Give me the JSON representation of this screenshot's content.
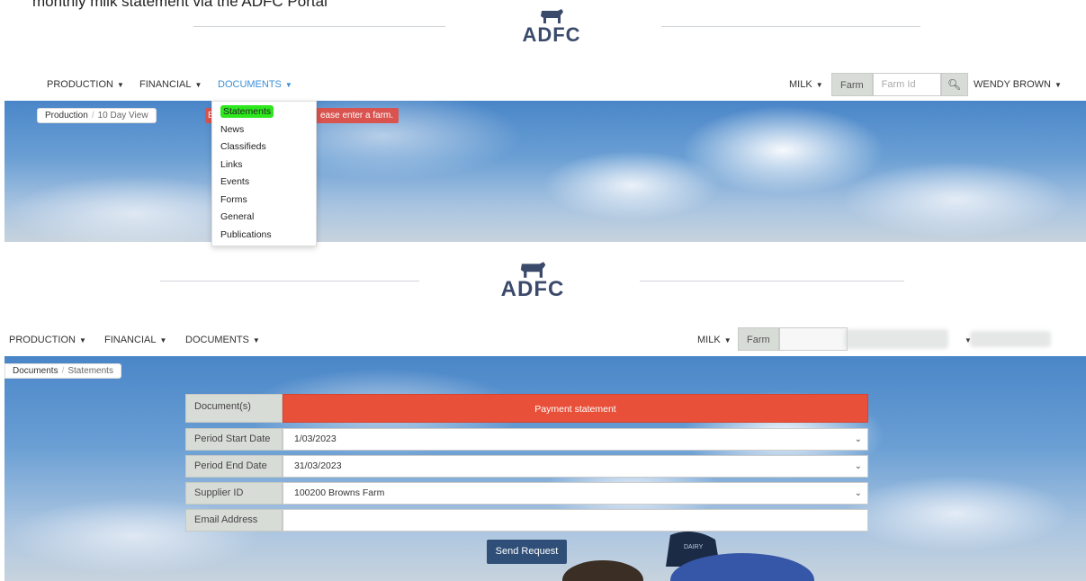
{
  "caption": "monthly milk statement via the ADFC Portal",
  "brand": {
    "name": "ADFC",
    "accent": "#3b4a6b"
  },
  "top": {
    "nav": {
      "production": "PRODUCTION",
      "financial": "FINANCIAL",
      "documents": "DOCUMENTS",
      "milk": "MILK",
      "farm_label": "Farm",
      "farm_placeholder": "Farm Id",
      "search_icon": "search-icon",
      "user": "WENDY BROWN"
    },
    "breadcrumb": {
      "section": "Production",
      "page": "10 Day View"
    },
    "alert_left": "E",
    "alert": "ease enter a farm.",
    "dropdown": [
      "Statements",
      "News",
      "Classifieds",
      "Links",
      "Events",
      "Forms",
      "General",
      "Publications"
    ],
    "highlight_color": "#2ee81e"
  },
  "bottom": {
    "nav": {
      "production": "PRODUCTION",
      "financial": "FINANCIAL",
      "documents": "DOCUMENTS",
      "milk": "MILK",
      "farm_label": "Farm"
    },
    "breadcrumb": {
      "section": "Documents",
      "page": "Statements"
    },
    "form": {
      "documents_label": "Document(s)",
      "documents_value": "Payment statement",
      "start_label": "Period Start Date",
      "start_value": "1/03/2023",
      "end_label": "Period End Date",
      "end_value": "31/03/2023",
      "supplier_label": "Supplier ID",
      "supplier_value": "100200 Browns Farm",
      "email_label": "Email Address",
      "email_value": "",
      "send_label": "Send Request"
    },
    "cap_text": "DAIRY"
  }
}
